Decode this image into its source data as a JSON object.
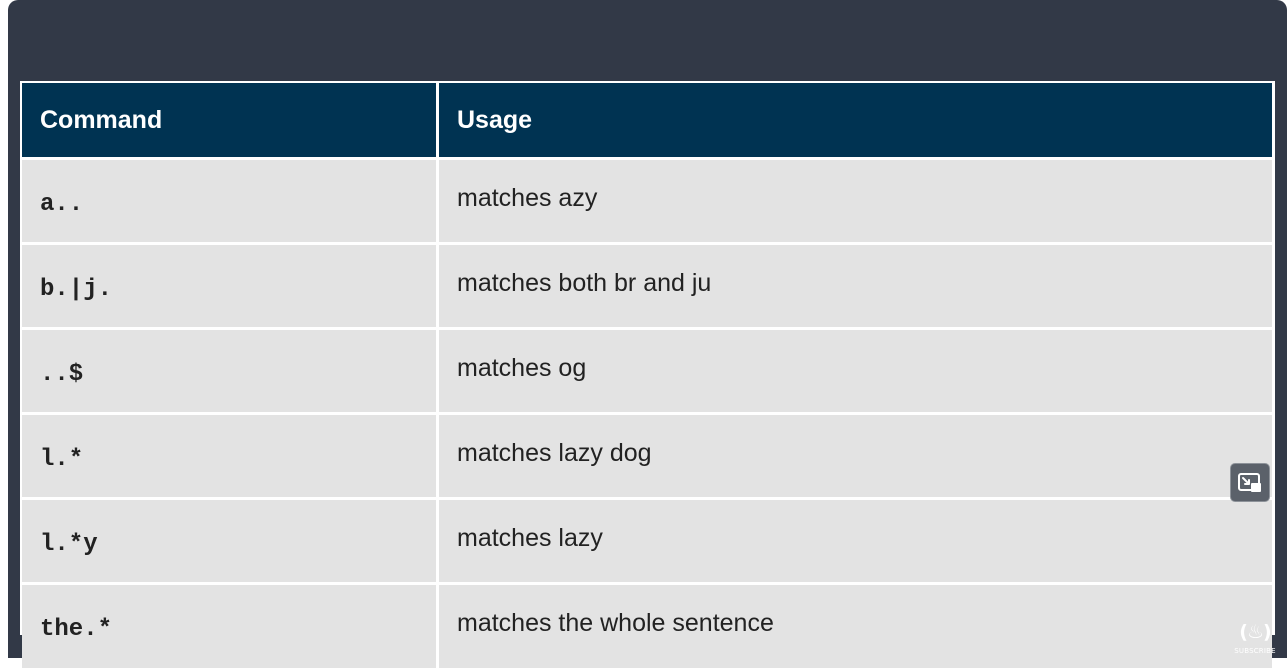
{
  "table": {
    "headers": {
      "command": "Command",
      "usage": "Usage"
    },
    "rows": [
      {
        "command": "a..",
        "usage": "matches azy"
      },
      {
        "command": "b.|j.",
        "usage": "matches both br and ju"
      },
      {
        "command": "..$",
        "usage": "matches og"
      },
      {
        "command": "l.*",
        "usage": "matches lazy dog"
      },
      {
        "command": "l.*y",
        "usage": "matches lazy"
      },
      {
        "command": "the.*",
        "usage": "matches the whole sentence"
      }
    ]
  },
  "overlay": {
    "pip_icon": "picture-in-picture-icon",
    "logo_icon": "freecodecamp-logo-icon",
    "logo_mark": "(♨)",
    "subscribe_label": "SUBSCRIBE"
  },
  "colors": {
    "frame_background": "#323947",
    "header_background": "#003352",
    "cell_background": "#e3e3e3",
    "header_text": "#ffffff",
    "cell_text": "#222222"
  }
}
